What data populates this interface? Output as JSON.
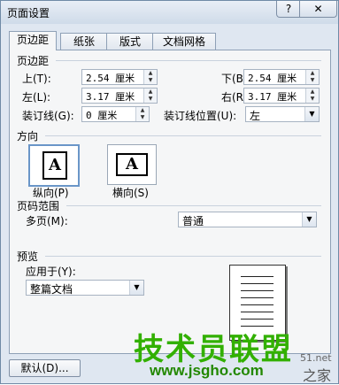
{
  "window": {
    "title": "页面设置",
    "help": "?",
    "close": "✕"
  },
  "tabs": [
    "页边距",
    "纸张",
    "版式",
    "文档网格"
  ],
  "margins": {
    "section": "页边距",
    "top_label": "上(T):",
    "top_value": "2.54 厘米",
    "bottom_label": "下(B):",
    "bottom_value": "2.54 厘米",
    "left_label": "左(L):",
    "left_value": "3.17 厘米",
    "right_label": "右(R):",
    "right_value": "3.17 厘米",
    "gutter_label": "装订线(G):",
    "gutter_value": "0 厘米",
    "gutter_pos_label": "装订线位置(U):",
    "gutter_pos_value": "左"
  },
  "orientation": {
    "section": "方向",
    "glyph": "A",
    "portrait": "纵向(P)",
    "landscape": "横向(S)",
    "selected": "portrait"
  },
  "pages": {
    "section": "页码范围",
    "multiple_label": "多页(M):",
    "multiple_value": "普通"
  },
  "preview": {
    "section": "预览",
    "apply_label": "应用于(Y):",
    "apply_value": "整篇文档"
  },
  "buttons": {
    "default": "默认(D)..."
  },
  "watermark": {
    "brand": "技术员联盟",
    "url": "www.jsgho.com",
    "side_top": "51.net",
    "side_bottom": "之家"
  }
}
